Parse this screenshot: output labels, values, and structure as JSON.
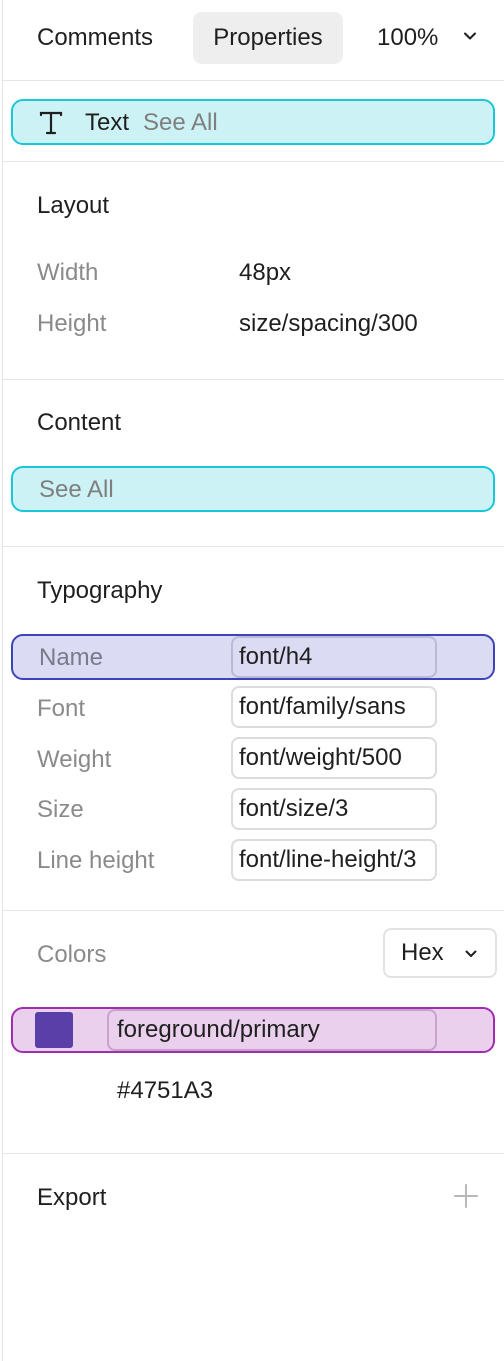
{
  "topbar": {
    "tabs": [
      "Comments",
      "Properties"
    ],
    "zoom": "100%",
    "zoom_icon": "chevron-down-icon"
  },
  "selection": {
    "type_icon": "text-type-icon",
    "type_label": "Text",
    "see_all": "See All",
    "highlight_color": "#19c7d9"
  },
  "layout": {
    "title": "Layout",
    "rows": [
      {
        "label": "Width",
        "value": "48px"
      },
      {
        "label": "Height",
        "value": "size/spacing/300"
      }
    ]
  },
  "content": {
    "title": "Content",
    "see_all": "See All"
  },
  "typography": {
    "title": "Typography",
    "highlight_color": "#3d43b8",
    "rows": [
      {
        "label": "Name",
        "value": "font/h4"
      },
      {
        "label": "Font",
        "value": "font/family/sans"
      },
      {
        "label": "Weight",
        "value": "font/weight/500"
      },
      {
        "label": "Size",
        "value": "font/size/3"
      },
      {
        "label": "Line height",
        "value": "font/line-height/3"
      }
    ]
  },
  "colors": {
    "title": "Colors",
    "format": "Hex",
    "format_icon": "chevron-down-icon",
    "highlight_color": "#a02cae",
    "items": [
      {
        "token": "foreground/primary",
        "hex": "#4751A3",
        "swatch": "#5b3fa8"
      }
    ]
  },
  "export": {
    "title": "Export",
    "add_icon": "plus-icon"
  }
}
